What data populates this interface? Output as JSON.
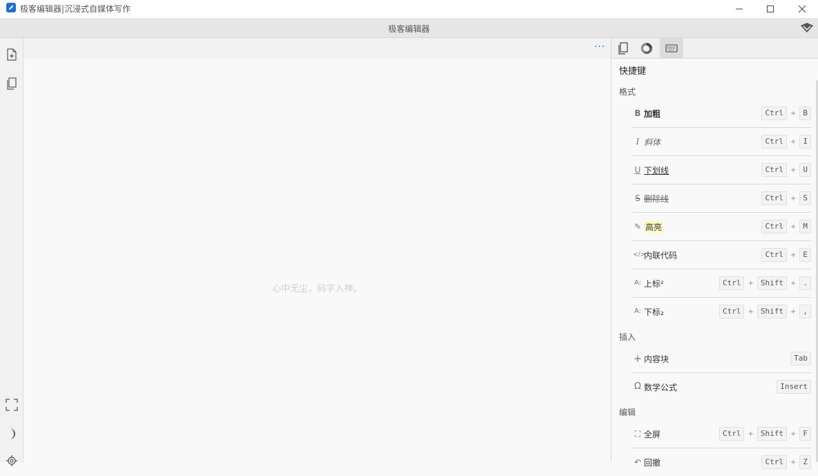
{
  "window": {
    "title": "极客编辑器|沉浸式自媒体写作"
  },
  "app": {
    "title": "极客编辑器"
  },
  "editor": {
    "placeholder": "心中无尘，码字入神。",
    "more_label": "···"
  },
  "panel": {
    "title": "快捷键",
    "active_tab": "keyboard",
    "sections": [
      {
        "title": "格式",
        "items": [
          {
            "icon": "B",
            "label": "加粗",
            "keys": [
              "Ctrl",
              "B"
            ]
          },
          {
            "icon": "I",
            "label": "斜体",
            "keys": [
              "Ctrl",
              "I"
            ]
          },
          {
            "icon": "U",
            "label": "下划线",
            "keys": [
              "Ctrl",
              "U"
            ]
          },
          {
            "icon": "S",
            "label": "删除线",
            "keys": [
              "Ctrl",
              "S"
            ]
          },
          {
            "icon": "✎",
            "label": "高亮",
            "keys": [
              "Ctrl",
              "M"
            ]
          },
          {
            "icon": "</>",
            "label": "内联代码",
            "keys": [
              "Ctrl",
              "E"
            ]
          },
          {
            "icon": "A:",
            "label": "上标²",
            "keys": [
              "Ctrl",
              "Shift",
              "."
            ]
          },
          {
            "icon": "A:",
            "label": "下标₂",
            "keys": [
              "Ctrl",
              "Shift",
              ","
            ]
          }
        ]
      },
      {
        "title": "插入",
        "items": [
          {
            "icon": "+",
            "label": "内容块",
            "keys": [
              "Tab"
            ]
          },
          {
            "icon": "Ω",
            "label": "数学公式",
            "keys": [
              "Insert"
            ]
          }
        ]
      },
      {
        "title": "编辑",
        "items": [
          {
            "icon": "⛶",
            "label": "全屏",
            "keys": [
              "Ctrl",
              "Shift",
              "F"
            ]
          },
          {
            "icon": "↶",
            "label": "回撤",
            "keys": [
              "Ctrl",
              "Z"
            ]
          }
        ]
      }
    ]
  },
  "colors": {
    "accent": "#1e6fd9",
    "highlight": "#fff9c4"
  }
}
